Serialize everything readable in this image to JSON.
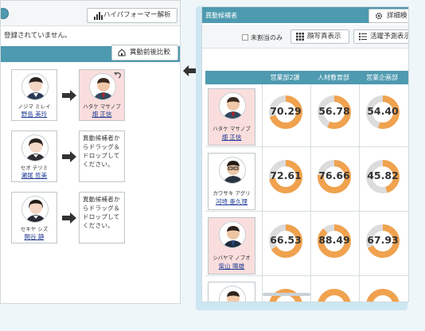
{
  "left_panel": {
    "performer_button": "ハイパフォーマー解析",
    "notice": "登録されていません。",
    "compare_button": "異動前後比較",
    "rows": [
      {
        "source": {
          "kana": "ノジマ ミレイ",
          "name": "野島 美玲"
        },
        "target": {
          "type": "person",
          "kana": "ハタケ マサノブ",
          "name": "畑 正信"
        }
      },
      {
        "source": {
          "kana": "セオ テツミ",
          "name": "瀬尾 哲美"
        },
        "target": {
          "type": "drop",
          "text": "異動候補者からドラッグ＆ドロップしてください。"
        }
      },
      {
        "source": {
          "kana": "セキヤ シズ",
          "name": "関谷 静"
        },
        "target": {
          "type": "drop",
          "text": "異動候補者からドラッグ＆ドロップしてください。"
        }
      }
    ]
  },
  "right_panel": {
    "title": "異動候補者",
    "detail_button": "詳細検",
    "unassigned_label": "未割当のみ",
    "photo_button": "顔写真表示",
    "predict_button": "活躍予測表示",
    "columns": [
      "営業部2課",
      "人材教育部",
      "営業企画部"
    ],
    "candidates": [
      {
        "kana": "ハタケ マサノブ",
        "name": "畑 正信",
        "highlight": true,
        "scores": [
          70.29,
          56.78,
          54.4
        ],
        "score_labels": [
          "70.29",
          "56.78",
          "54.40"
        ]
      },
      {
        "kana": "カワサキ アグリ",
        "name": "河埼 亜久理",
        "highlight": false,
        "scores": [
          72.61,
          76.66,
          45.82
        ],
        "score_labels": [
          "72.61",
          "76.66",
          "45.82"
        ]
      },
      {
        "kana": "シバヤマ ノブオ",
        "name": "柴山 陳雄",
        "highlight": true,
        "scores": [
          66.53,
          88.49,
          67.93
        ],
        "score_labels": [
          "66.53",
          "88.49",
          "67.93"
        ]
      },
      {
        "kana": "",
        "name": "",
        "highlight": false,
        "scores": [],
        "score_labels": []
      }
    ]
  },
  "colors": {
    "accent": "#4e9ab0",
    "gauge_fill": "#f0a24e",
    "gauge_track": "#dcdcdc",
    "highlight": "#f9dedd",
    "link": "#1f3a93"
  }
}
